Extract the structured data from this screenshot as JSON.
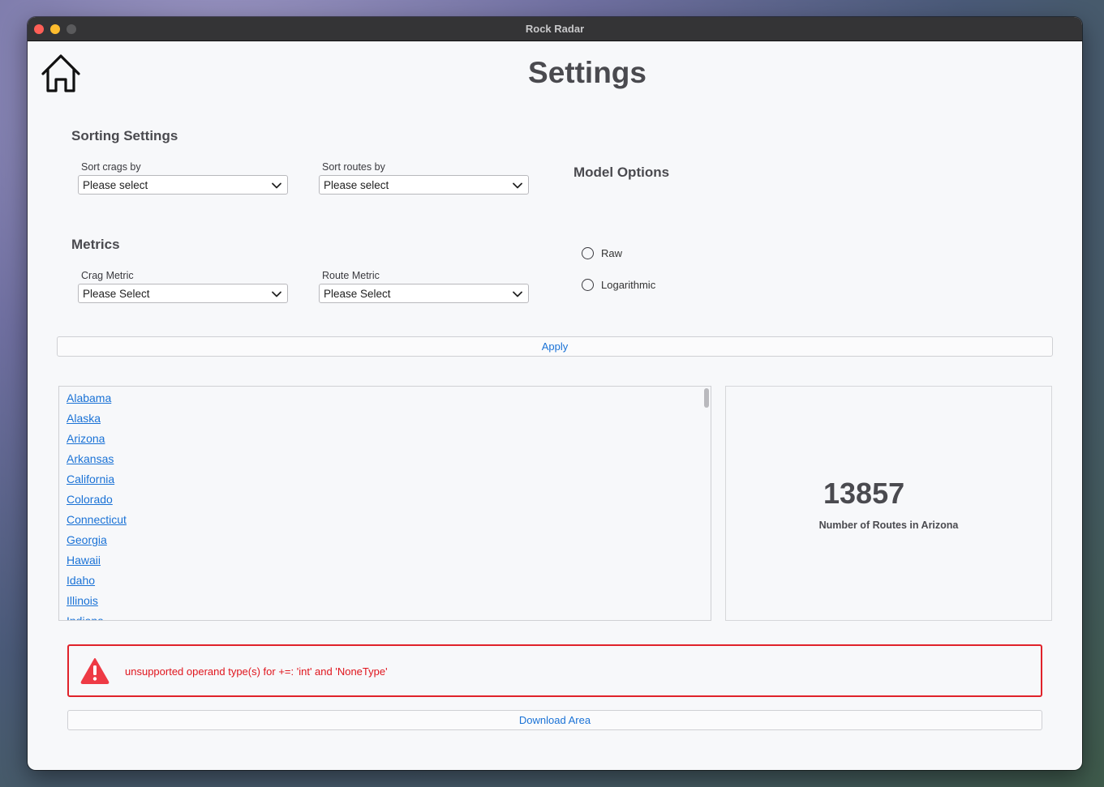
{
  "window": {
    "title": "Rock Radar"
  },
  "page": {
    "title": "Settings"
  },
  "sorting": {
    "heading": "Sorting Settings",
    "crags_label": "Sort crags by",
    "crags_value": "Please select",
    "routes_label": "Sort routes by",
    "routes_value": "Please select"
  },
  "metrics": {
    "heading": "Metrics",
    "crag_label": "Crag Metric",
    "crag_value": "Please Select",
    "route_label": "Route Metric",
    "route_value": "Please Select"
  },
  "model_options": {
    "heading": "Model Options",
    "options": [
      {
        "label": "Raw",
        "selected": false
      },
      {
        "label": "Logarithmic",
        "selected": false
      }
    ]
  },
  "apply_label": "Apply",
  "states": [
    "Alabama",
    "Alaska",
    "Arizona",
    "Arkansas",
    "California",
    "Colorado",
    "Connecticut",
    "Georgia",
    "Hawaii",
    "Idaho",
    "Illinois",
    "Indiana"
  ],
  "metric_card": {
    "value": "13857",
    "caption": "Number of Routes in Arizona"
  },
  "error": {
    "message": "unsupported operand type(s) for +=: 'int' and 'NoneType'"
  },
  "download_label": "Download Area",
  "colors": {
    "accent": "#1a72d6",
    "error": "#e0222a",
    "background": "#f7f8fa"
  },
  "icons": {
    "home": "home-icon",
    "select": "chevron-down-icon",
    "error": "warning-triangle-icon"
  }
}
